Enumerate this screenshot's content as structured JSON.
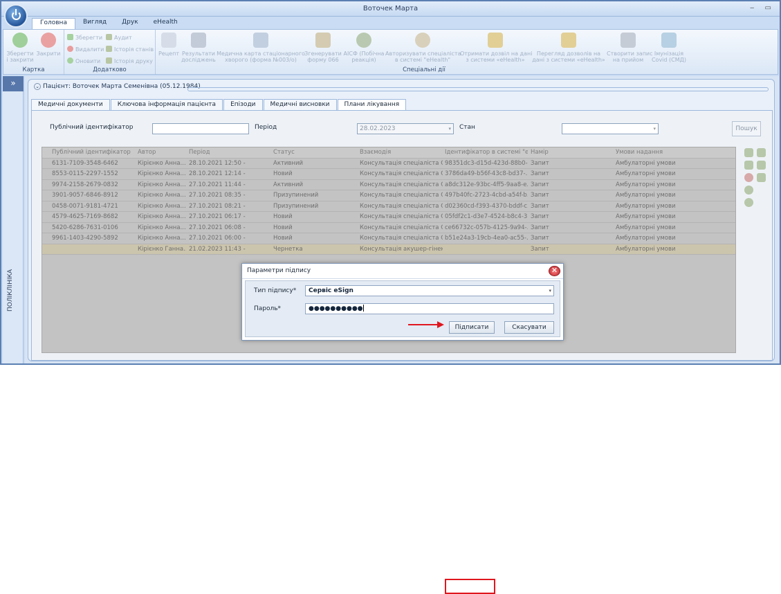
{
  "window": {
    "title": "Воточек Марта",
    "controls": "‒ ▭"
  },
  "menu_tabs": [
    "Головна",
    "Вигляд",
    "Друк",
    "eHealth"
  ],
  "ribbon": {
    "groups": {
      "card": "Картка",
      "extra": "Додатково",
      "special": "Спеціальні дії"
    },
    "card_buttons": [
      "Зберегти\nі закрити",
      "Закрити"
    ],
    "extra_buttons": [
      "Зберегти",
      "Видалити",
      "Оновити",
      "Аудит",
      "Історія станів",
      "Історія друку"
    ],
    "special_buttons": [
      "Рецепт",
      "Результати\nдосліджень",
      "Медична карта стаціонарного\nхворого (форма №003/о)",
      "Згенерувати\nформу 066",
      "АІСФ (Побічна\nреакція)",
      "Авторизувати спеціаліста\nв системі \"eHealth\"",
      "Отримати дозвіл на дані\nз системи «eHealth»",
      "Перегляд дозволів на\nдані з системи «eHealth»",
      "Створити запис\nна прийом",
      "Імунізація\nCovid (СМД)"
    ]
  },
  "sidebar": {
    "toggle": "»",
    "label": "ПОЛІКЛІНІКА"
  },
  "patient": {
    "title": "Пацієнт: Воточек Марта Семенівна (05.12.1984)"
  },
  "inner_tabs": [
    "Медичні документи",
    "Ключова інформація пацієнта",
    "Епізоди",
    "Медичні висновки",
    "Плани лікування"
  ],
  "filters": {
    "public_id_label": "Публічний ідентифікатор",
    "public_id_value": "",
    "period_label": "Період",
    "period_value": "28.02.2023",
    "state_label": "Стан",
    "state_value": "",
    "search_button": "Пошук"
  },
  "table": {
    "columns": [
      "Публічний ідентифікатор",
      "Автор",
      "Період",
      "Статус",
      "Взаємодія",
      "Ідентифікатор в системі \"eHe",
      "Намір",
      "Умови надання"
    ],
    "rows": [
      [
        "6131-7109-3548-6462",
        "Кірієнко Анна...",
        "28.10.2021 12:50 -",
        "Активний",
        "Консультація спеціаліста С...",
        "98351dc3-d15d-423d-88b0-...",
        "Запит",
        "Амбулаторні умови"
      ],
      [
        "8553-0115-2297-1552",
        "Кірієнко Анна...",
        "28.10.2021 12:14 -",
        "Новий",
        "Консультація спеціаліста С...",
        "3786da49-b56f-43c8-bd37-...",
        "Запит",
        "Амбулаторні умови"
      ],
      [
        "9974-2158-2679-0832",
        "Кірієнко Анна...",
        "27.10.2021 11:44 -",
        "Активний",
        "Консультація спеціаліста С...",
        "a8dc312e-93bc-4ff5-9aa8-e...",
        "Запит",
        "Амбулаторні умови"
      ],
      [
        "3901-9057-6846-8912",
        "Кірієнко Анна...",
        "27.10.2021 08:35 -",
        "Призупинений",
        "Консультація спеціаліста С...",
        "497b40fc-2723-4cbd-a54f-b...",
        "Запит",
        "Амбулаторні умови"
      ],
      [
        "0458-0071-9181-4721",
        "Кірієнко Анна...",
        "27.10.2021 08:21 -",
        "Призупинений",
        "Консультація спеціаліста С...",
        "d02360cd-f393-4370-bddf-c...",
        "Запит",
        "Амбулаторні умови"
      ],
      [
        "4579-4625-7169-8682",
        "Кірієнко Анна...",
        "27.10.2021 06:17 -",
        "Новий",
        "Консультація спеціаліста С...",
        "05fdf2c1-d3e7-4524-b8c4-3...",
        "Запит",
        "Амбулаторні умови"
      ],
      [
        "5420-6286-7631-0106",
        "Кірієнко Анна...",
        "27.10.2021 06:08 -",
        "Новий",
        "Консультація спеціаліста С...",
        "ce66732c-057b-4125-9a94-...",
        "Запит",
        "Амбулаторні умови"
      ],
      [
        "9961-1403-4290-5892",
        "Кірієнко Анна...",
        "27.10.2021 06:00 -",
        "Новий",
        "Консультація спеціаліста С...",
        "b51e24a3-19cb-4ea0-ac55-...",
        "Запит",
        "Амбулаторні умови"
      ],
      [
        "",
        "Кірієнко Ганна...",
        "21.02.2023 11:43 -",
        "Чернетка",
        "Консультація акушер-гінек...",
        "",
        "Запит",
        "Амбулаторні умови"
      ]
    ]
  },
  "dialog": {
    "title": "Параметри підпису",
    "sign_type_label": "Тип підпису*",
    "sign_type_value": "Сервіс eSign",
    "password_label": "Пароль*",
    "password_value": "●●●●●●●●●●",
    "sign_button": "Підписати",
    "cancel_button": "Скасувати"
  },
  "colors": {
    "highlight": "#e0161e",
    "accent": "#5777ab"
  }
}
